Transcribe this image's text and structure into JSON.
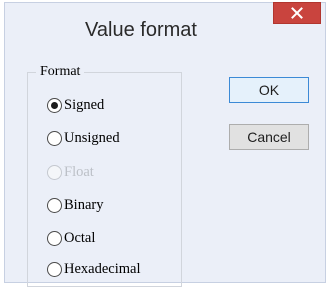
{
  "dialog": {
    "title": "Value format",
    "close_icon": "close-x-icon"
  },
  "format_group": {
    "label": "Format",
    "options": [
      {
        "label": "Signed",
        "selected": true,
        "enabled": true
      },
      {
        "label": "Unsigned",
        "selected": false,
        "enabled": true
      },
      {
        "label": "Float",
        "selected": false,
        "enabled": false
      },
      {
        "label": "Binary",
        "selected": false,
        "enabled": true
      },
      {
        "label": "Octal",
        "selected": false,
        "enabled": true
      },
      {
        "label": "Hexadecimal",
        "selected": false,
        "enabled": true
      }
    ]
  },
  "buttons": {
    "ok_label": "OK",
    "cancel_label": "Cancel"
  },
  "colors": {
    "dialog_background": "#ebeff8",
    "close_button": "#c9443e",
    "default_button_border": "#3c8ad6"
  }
}
